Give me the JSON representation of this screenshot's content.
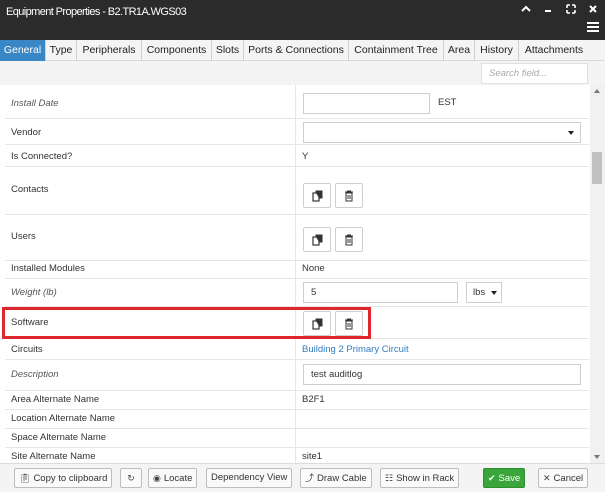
{
  "window": {
    "title": "Equipment Properties - B2.TR1A.WGS03"
  },
  "tabs": [
    {
      "label": "General"
    },
    {
      "label": "Type"
    },
    {
      "label": "Peripherals"
    },
    {
      "label": "Components"
    },
    {
      "label": "Slots"
    },
    {
      "label": "Ports & Connections"
    },
    {
      "label": "Containment Tree"
    },
    {
      "label": "Area"
    },
    {
      "label": "History"
    },
    {
      "label": "Attachments"
    }
  ],
  "search": {
    "placeholder": "Search field..."
  },
  "properties": {
    "install_date": {
      "label": "Install Date",
      "value": "",
      "timezone": "EST"
    },
    "vendor": {
      "label": "Vendor",
      "value": ""
    },
    "is_connected": {
      "label": "Is Connected?",
      "value": "Y"
    },
    "contacts": {
      "label": "Contacts"
    },
    "users": {
      "label": "Users"
    },
    "installed_modules": {
      "label": "Installed Modules",
      "value": "None"
    },
    "weight": {
      "label": "Weight (lb)",
      "value": "5",
      "unit": "lbs"
    },
    "software": {
      "label": "Software"
    },
    "circuits": {
      "label": "Circuits",
      "value": "Building 2 Primary Circuit"
    },
    "description": {
      "label": "Description",
      "value": "test auditlog"
    },
    "area_alternate_name": {
      "label": "Area Alternate Name",
      "value": "B2F1"
    },
    "location_alternate_name": {
      "label": "Location Alternate Name",
      "value": ""
    },
    "space_alternate_name": {
      "label": "Space Alternate Name",
      "value": ""
    },
    "site_alternate_name": {
      "label": "Site Alternate Name",
      "value": "site1"
    }
  },
  "footer": {
    "copy_label": "Copy to clipboard",
    "locate_label": "Locate",
    "dependency_label": "Dependency View",
    "draw_cable_label": "Draw Cable",
    "show_in_rack_label": "Show in Rack",
    "save_label": "Save",
    "cancel_label": "Cancel"
  },
  "colors": {
    "accent": "#3a87c6",
    "titlebar": "#2b2b2b",
    "save": "#3aa53a",
    "highlight": "#e1252d",
    "link": "#2f7cc1"
  }
}
